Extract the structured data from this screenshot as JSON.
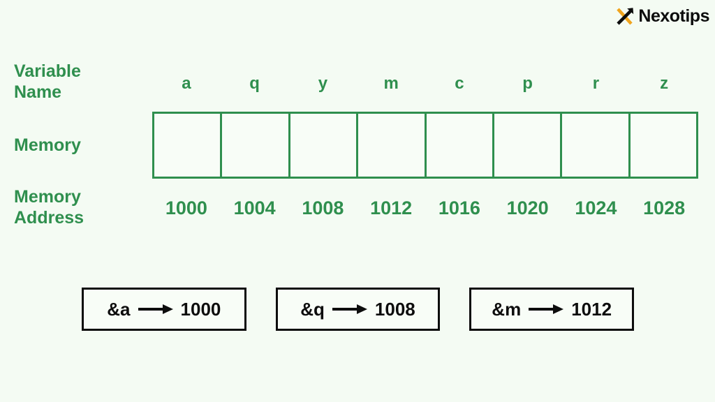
{
  "brand": {
    "name": "Nexotips",
    "mark_icon": "nexotips-x-arrow-icon",
    "mark_color_primary": "#f0a41e",
    "mark_color_secondary": "#0d0d0d"
  },
  "theme": {
    "background": "#f4fbf3",
    "green": "#2f8f4e",
    "black": "#0d0d0d"
  },
  "labels": {
    "variable_name": "Variable\nName",
    "memory": "Memory",
    "memory_address": "Memory\nAddress"
  },
  "table": {
    "variable_names": [
      "a",
      "q",
      "y",
      "m",
      "c",
      "p",
      "r",
      "z"
    ],
    "cells": [
      "",
      "",
      "",
      "",
      "",
      "",
      "",
      ""
    ],
    "addresses": [
      "1000",
      "1004",
      "1008",
      "1012",
      "1016",
      "1020",
      "1024",
      "1028"
    ]
  },
  "pointer_boxes": [
    {
      "expr": "&a",
      "arrow": "right-arrow-icon",
      "value": "1000"
    },
    {
      "expr": "&q",
      "arrow": "right-arrow-icon",
      "value": "1008"
    },
    {
      "expr": "&m",
      "arrow": "right-arrow-icon",
      "value": "1012"
    }
  ]
}
